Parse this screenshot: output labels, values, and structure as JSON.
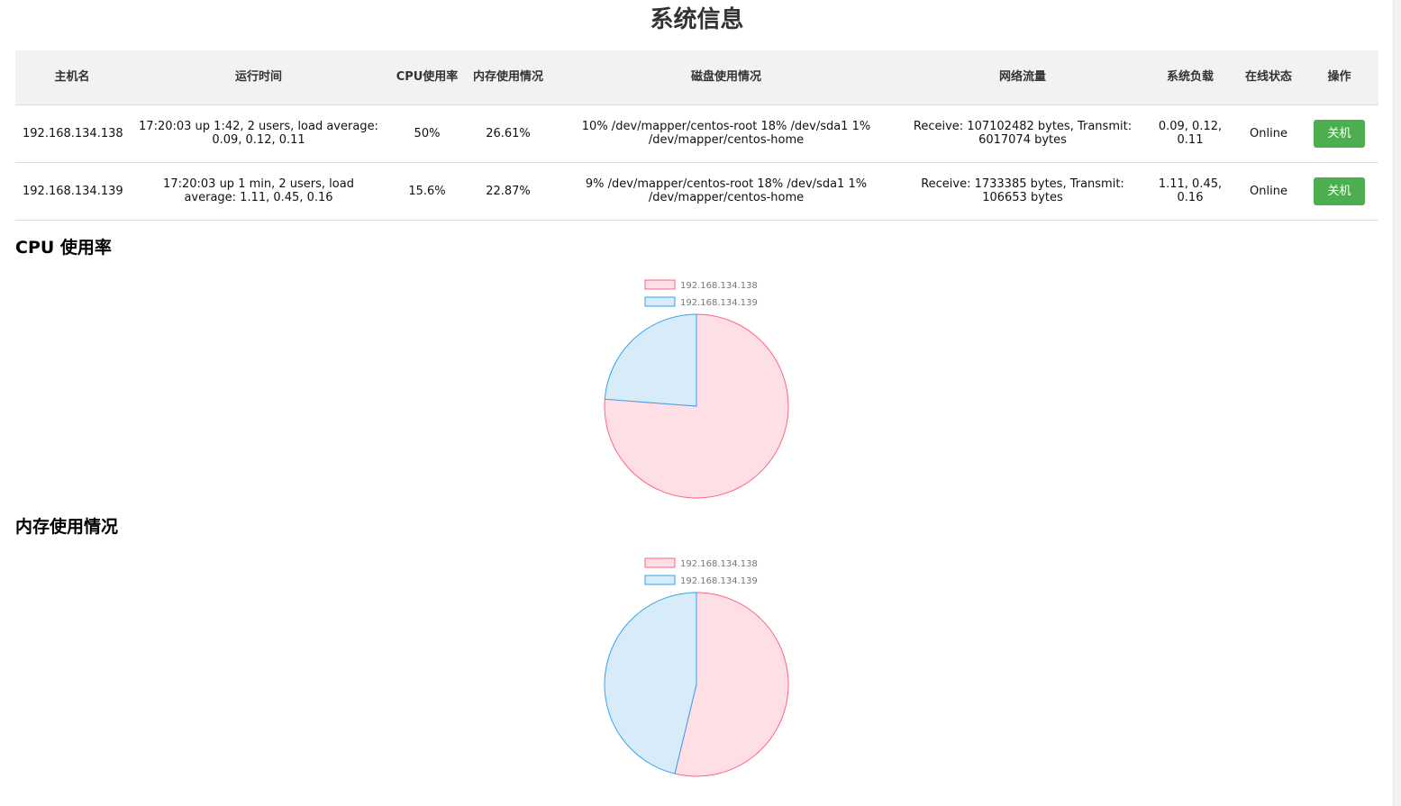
{
  "page_title": "系统信息",
  "table": {
    "headers": [
      "主机名",
      "运行时间",
      "CPU使用率",
      "内存使用情况",
      "磁盘使用情况",
      "网络流量",
      "系统负载",
      "在线状态",
      "操作"
    ],
    "rows": [
      {
        "hostname": "192.168.134.138",
        "uptime": "17:20:03 up 1:42, 2 users, load average: 0.09, 0.12, 0.11",
        "cpu": "50%",
        "memory": "26.61%",
        "disk": "10% /dev/mapper/centos-root 18% /dev/sda1 1% /dev/mapper/centos-home",
        "network": "Receive: 107102482 bytes, Transmit: 6017074 bytes",
        "load": "0.09, 0.12, 0.11",
        "status": "Online",
        "action_label": "关机"
      },
      {
        "hostname": "192.168.134.139",
        "uptime": "17:20:03 up 1 min, 2 users, load average: 1.11, 0.45, 0.16",
        "cpu": "15.6%",
        "memory": "22.87%",
        "disk": "9% /dev/mapper/centos-root 18% /dev/sda1 1% /dev/mapper/centos-home",
        "network": "Receive: 1733385 bytes, Transmit: 106653 bytes",
        "load": "1.11, 0.45, 0.16",
        "status": "Online",
        "action_label": "关机"
      }
    ]
  },
  "cpu_section_title": "CPU 使用率",
  "memory_section_title": "内存使用情况",
  "colors": {
    "slice_1_fill": "#ffdfe6",
    "slice_1_stroke": "#ff6384",
    "slice_2_fill": "#d7ebf9",
    "slice_2_stroke": "#36a2eb",
    "button": "#4cae4f",
    "header_bg": "#f2f2f2"
  },
  "chart_data": [
    {
      "type": "pie",
      "title": "CPU 使用率",
      "categories": [
        "192.168.134.138",
        "192.168.134.139"
      ],
      "values": [
        50,
        15.6
      ],
      "legend": "top"
    },
    {
      "type": "pie",
      "title": "内存使用情况",
      "categories": [
        "192.168.134.138",
        "192.168.134.139"
      ],
      "values": [
        26.61,
        22.87
      ],
      "legend": "top"
    }
  ]
}
